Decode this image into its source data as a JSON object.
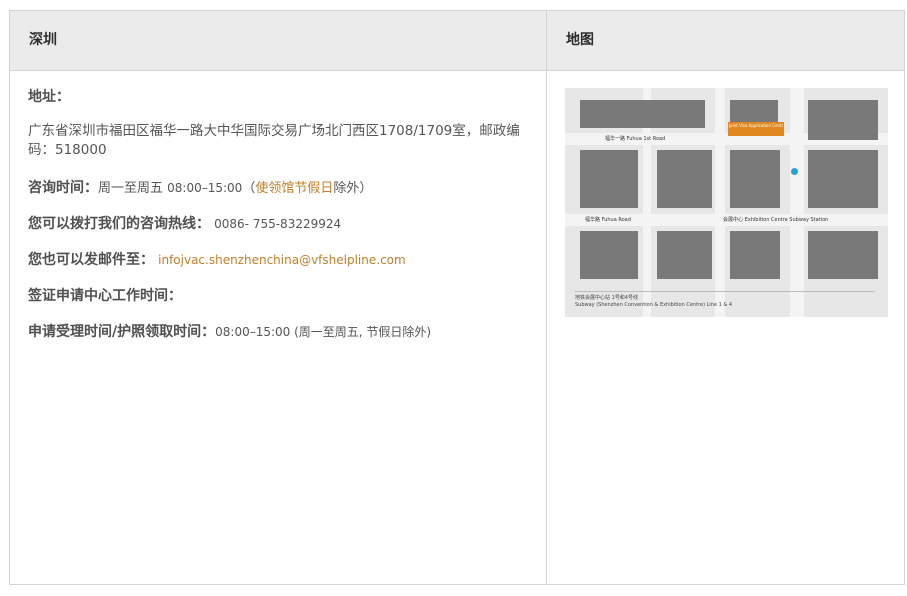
{
  "header": {
    "city": "深圳",
    "map": "地图"
  },
  "address": {
    "label": "地址：",
    "text": "广东省深圳市福田区福华一路大中华国际交易广场北门西区1708/1709室，邮政编码：518000"
  },
  "hours": {
    "label": "咨询时间：",
    "days": "周一至周五",
    "time": "08:00–15:00",
    "paren_open": "（",
    "holiday_link": "使领馆节假日",
    "except": "除外）"
  },
  "hotline": {
    "label": "您可以拨打我们的咨询热线：",
    "number": "0086- 755-83229924"
  },
  "email": {
    "label": "您也可以发邮件至：",
    "address": "infojvac.shenzhenchina@vfshelpline.com"
  },
  "work_hours": {
    "label": "签证申请中心工作时间："
  },
  "submission": {
    "label": "申请受理时间/护照领取时间：",
    "text": "08:00–15:00 (周一至周五, 节假日除外)"
  },
  "map_image": {
    "road_fuhua": "福华一路 Fuhua 1st Road",
    "road_fuhua3": "福华路 Fuhua Road",
    "station": "会展中心 Exhibition Centre Subway Station",
    "center_label": "Joint Visa Application Centre 日本签证申请中心",
    "note1": "地铁会展中心站 1号和4号线",
    "note2": "Subway (Shenzhen Convention & Exhibition Centre) Line 1 & 4"
  }
}
